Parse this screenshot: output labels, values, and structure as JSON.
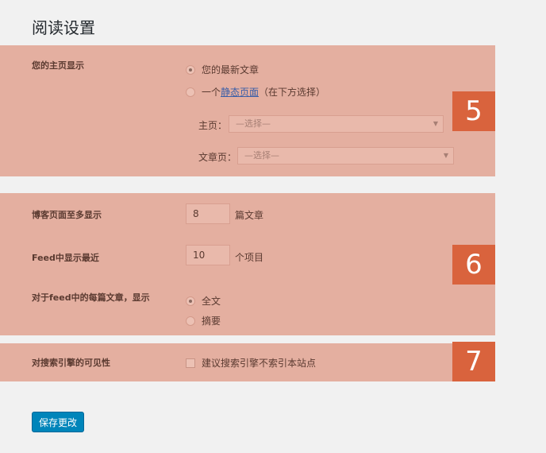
{
  "page": {
    "title": "阅读设置"
  },
  "front_page": {
    "badge": "5",
    "label": "您的主页显示",
    "option_latest": "您的最新文章",
    "option_static_prefix": "一个",
    "option_static_link": "静态页面",
    "option_static_suffix": "（在下方选择）",
    "homepage_label": "主页：",
    "homepage_select": "—选择—",
    "posts_page_label": "文章页：",
    "posts_page_select": "—选择—"
  },
  "posts": {
    "badge": "6",
    "blog_pages_label": "博客页面至多显示",
    "blog_pages_value": "8",
    "blog_pages_unit": "篇文章",
    "feed_label": "Feed中显示最近",
    "feed_value": "10",
    "feed_unit": "个项目",
    "feed_content_label": "对于feed中的每篇文章，显示",
    "feed_full": "全文",
    "feed_summary": "摘要"
  },
  "visibility": {
    "badge": "7",
    "label": "对搜索引擎的可见性",
    "checkbox_label": "建议搜索引擎不索引本站点"
  },
  "actions": {
    "save_label": "保存更改"
  }
}
